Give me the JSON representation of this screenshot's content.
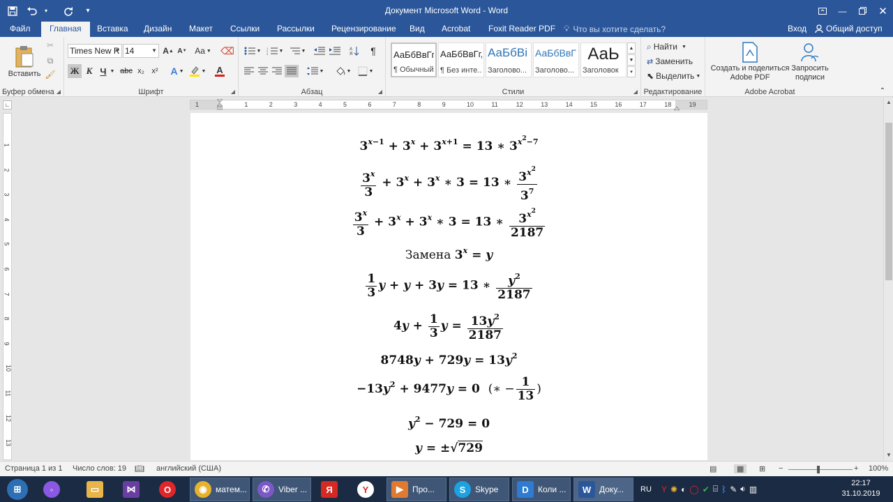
{
  "window": {
    "title": "Документ Microsoft Word - Word"
  },
  "tabs": {
    "file": "Файл",
    "home": "Главная",
    "insert": "Вставка",
    "design": "Дизайн",
    "layout": "Макет",
    "references": "Ссылки",
    "mailings": "Рассылки",
    "review": "Рецензирование",
    "view": "Вид",
    "acrobat": "Acrobat",
    "foxit": "Foxit Reader PDF",
    "tell_me": "Что вы хотите сделать?",
    "login": "Вход",
    "share": "Общий доступ"
  },
  "ribbon": {
    "clipboard": {
      "label": "Буфер обмена",
      "paste": "Вставить"
    },
    "font": {
      "label": "Шрифт",
      "name": "Times New R",
      "size": "14",
      "bold": "Ж",
      "italic": "К",
      "underline": "Ч",
      "strike": "abc",
      "sub": "x₂",
      "sup": "x²",
      "grow": "A",
      "shrink": "A",
      "case": "Aa",
      "color": "A"
    },
    "paragraph": {
      "label": "Абзац"
    },
    "styles": {
      "label": "Стили",
      "items": [
        {
          "preview": "АаБбВвГг,",
          "name": "¶ Обычный"
        },
        {
          "preview": "АаБбВвГг,",
          "name": "¶ Без инте..."
        },
        {
          "preview": "АаБбВі",
          "name": "Заголово..."
        },
        {
          "preview": "АаБбВвГ",
          "name": "Заголово..."
        },
        {
          "preview": "АаЬ",
          "name": "Заголовок"
        }
      ]
    },
    "editing": {
      "label": "Редактирование",
      "find": "Найти",
      "replace": "Заменить",
      "select": "Выделить"
    },
    "acrobat": {
      "label": "Adobe Acrobat",
      "create": "Создать и поделиться Adobe PDF",
      "request": "Запросить подписи"
    }
  },
  "ruler": {
    "numbers": [
      "1",
      "1",
      "2",
      "3",
      "4",
      "5",
      "6",
      "7",
      "8",
      "9",
      "10",
      "11",
      "12",
      "13",
      "14",
      "15",
      "16",
      "17",
      "18",
      "19"
    ],
    "vnumbers": [
      "1",
      "2",
      "3",
      "4",
      "5",
      "6",
      "7",
      "8",
      "9",
      "10",
      "11",
      "12",
      "13"
    ]
  },
  "document": {
    "replace_word": "Замена",
    "numbers": {
      "n3": "3",
      "n13": "13",
      "n7": "7",
      "n2187": "2187",
      "n1": "1",
      "n4": "4",
      "n8748": "8748",
      "n729": "729",
      "n9477": "9477",
      "n0": "0",
      "n2": "2"
    },
    "vars": {
      "x": "x",
      "y": "y"
    }
  },
  "status": {
    "page": "Страница 1 из 1",
    "words": "Число слов: 19",
    "language": "английский (США)",
    "zoom": "100%",
    "zoom_level": 1.0
  },
  "taskbar": {
    "items": [
      {
        "label": "матем..."
      },
      {
        "label": "Viber ..."
      },
      {
        "label": "Про..."
      },
      {
        "label": "Skype"
      },
      {
        "label": "Коли ..."
      },
      {
        "label": "Доку..."
      }
    ],
    "lang": "RU",
    "time": "22:17",
    "date": "31.10.2019"
  }
}
